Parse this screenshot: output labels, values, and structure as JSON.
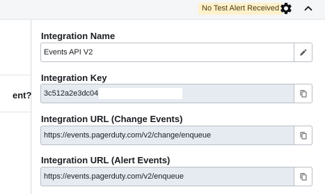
{
  "header": {
    "alert_badge": "No Test Alert Received",
    "settings_icon": "gear-icon",
    "collapse_icon": "chevron-up-icon"
  },
  "left_panel": {
    "partial_text": "ent?"
  },
  "integration": {
    "name_label": "Integration Name",
    "name_value": "Events API V2",
    "key_label": "Integration Key",
    "key_value": "3c512a2e3dc04",
    "change_url_label": "Integration URL (Change Events)",
    "change_url_value": "https://events.pagerduty.com/v2/change/enqueue",
    "alert_url_label": "Integration URL (Alert Events)",
    "alert_url_value": "https://events.pagerduty.com/v2/enqueue"
  },
  "colors": {
    "badge_bg": "#fff1cc",
    "readonly_field_bg": "#e6ebf1",
    "border": "#b9bec5"
  }
}
